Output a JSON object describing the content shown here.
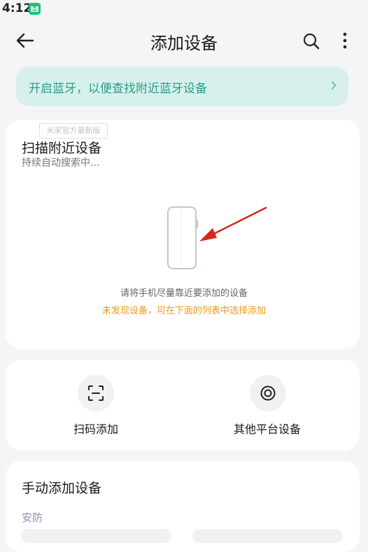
{
  "status_bar": {
    "time": "4:12",
    "app_icon": "mi-home-icon"
  },
  "header": {
    "title": "添加设备",
    "back_icon": "arrow-left-icon",
    "search_icon": "search-icon",
    "more_icon": "more-vertical-icon"
  },
  "bluetooth_banner": {
    "text": "开启蓝牙，以便查找附近蓝牙设备",
    "chevron": "›",
    "color": "#2a9e88"
  },
  "watermark": "米家官方最新版",
  "scan_section": {
    "title": "扫描附近设备",
    "subtitle": "持续自动搜索中...",
    "hint": "请将手机尽量靠近要添加的设备",
    "warning": "未发现设备，可在下面的列表中选择添加",
    "warning_color": "#eb9a1e"
  },
  "actions": [
    {
      "label": "扫码添加",
      "icon": "scan-qr-icon"
    },
    {
      "label": "其他平台设备",
      "icon": "other-platform-icon"
    }
  ],
  "manual_section": {
    "title": "手动添加设备",
    "category": "安防"
  }
}
